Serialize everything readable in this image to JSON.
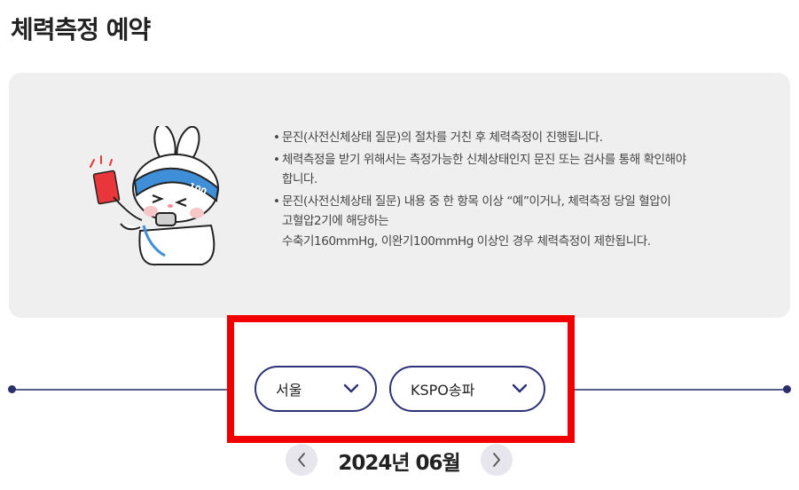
{
  "page": {
    "title": "체력측정 예약"
  },
  "notices": [
    {
      "lines": [
        "문진(사전신체상태 질문)의 절차를 거친 후 체력측정이 진행됩니다."
      ]
    },
    {
      "lines": [
        "체력측정을 받기 위해서는 측정가능한 신체상태인지 문진 또는 검사를 통해 확인해야",
        "합니다."
      ]
    },
    {
      "lines": [
        "문진(사전신체상태 질문) 내용 중 한 항목 이상 “예”이거나, 체력측정 당일 혈압이",
        "고혈압2기에 해당하는",
        "수축기160mmHg, 이완기100mmHg 이상인 경우 체력측정이 제한됩니다."
      ]
    }
  ],
  "mascot": {
    "headband_text": "100"
  },
  "filters": {
    "region": {
      "selected": "서울"
    },
    "center": {
      "selected": "KSPO송파"
    }
  },
  "calendar": {
    "month_label": "2024년 06월"
  },
  "colors": {
    "accent": "#2d3278",
    "highlight": "#f20000",
    "panel": "#efefef"
  },
  "icons": {
    "prev": "chevron-left-icon",
    "next": "chevron-right-icon",
    "dropdown": "chevron-down-icon"
  }
}
